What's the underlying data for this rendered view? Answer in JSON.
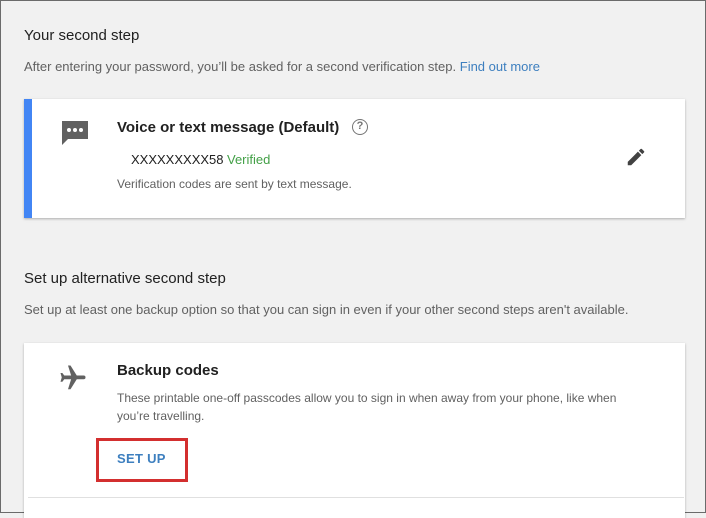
{
  "second_step": {
    "heading": "Your second step",
    "description": "After entering your password, you’ll be asked for a second verification step.",
    "link": "Find out more"
  },
  "voice_card": {
    "icon": "message-icon",
    "title": "Voice or text message (Default)",
    "help_glyph": "?",
    "phone": "XXXXXXXXX58",
    "status": "Verified",
    "note": "Verification codes are sent by text message.",
    "edit_icon": "pencil-icon",
    "accent_color": "#4285f4",
    "status_color": "#43a047"
  },
  "alternative": {
    "heading": "Set up alternative second step",
    "description": "Set up at least one backup option so that you can sign in even if your other second steps aren't available."
  },
  "backup_card": {
    "icon": "airplane-icon",
    "title": "Backup codes",
    "description_line1": "These printable one-off passcodes allow you to sign in when away from your phone, like when",
    "description_line2": "you’re travelling.",
    "action": "SET UP",
    "highlight_color": "#d32f2f"
  }
}
